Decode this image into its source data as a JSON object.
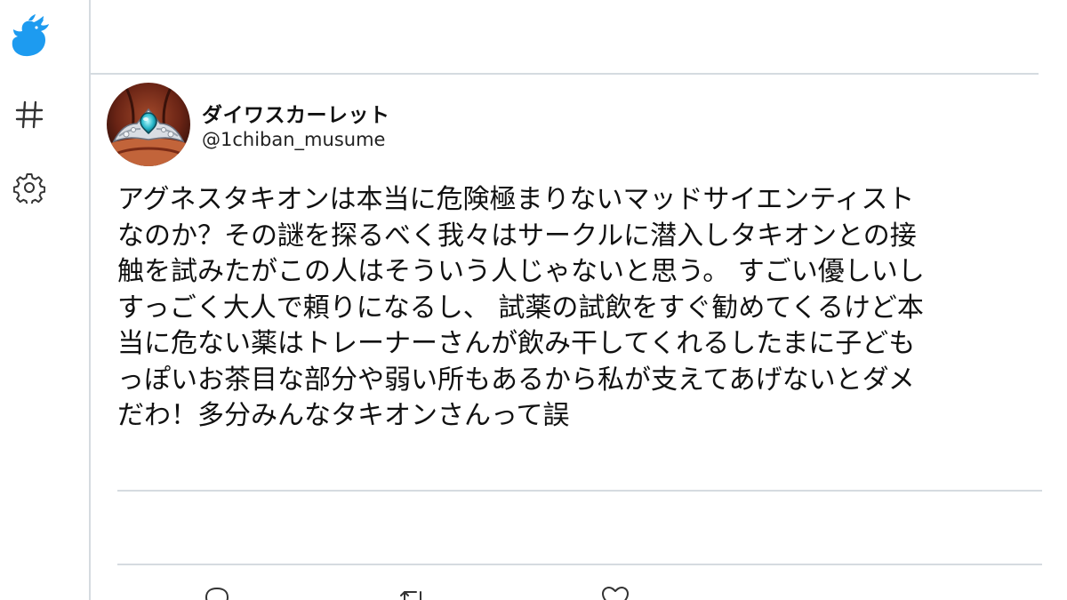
{
  "colors": {
    "accent": "#1d9bf0",
    "divider": "#d5dbe0",
    "text": "#111111"
  },
  "sidebar": {
    "logo_icon": "bird-logo-icon",
    "items": [
      {
        "icon": "hashtag-icon"
      },
      {
        "icon": "gear-icon"
      }
    ]
  },
  "tweet": {
    "author": {
      "display_name": "ダイワスカーレット",
      "handle": "@1chiban_musume",
      "avatar_icon": "avatar-tiara-image"
    },
    "lines": [
      "アグネスタキオンは本当に危険極まりないマッドサイエンティスト",
      "なのか？その謎を探るべく我々はサークルに潜入しタキオンとの接",
      "触を試みたがこの人はそういう人じゃないと思う。 すごい優しいし",
      "すっごく大人で頼りになるし、 試薬の試飲をすぐ勧めてくるけど本",
      "当に危ない薬はトレーナーさんが飲み干してくれるしたまに子ども",
      "っぽいお茶目な部分や弱い所もあるから私が支えてあげないとダメ",
      "だわ！多分みんなタキオンさんって誤"
    ],
    "actions": [
      {
        "name": "reply",
        "icon": "reply-icon"
      },
      {
        "name": "retweet",
        "icon": "retweet-icon"
      },
      {
        "name": "like",
        "icon": "heart-icon"
      }
    ]
  }
}
